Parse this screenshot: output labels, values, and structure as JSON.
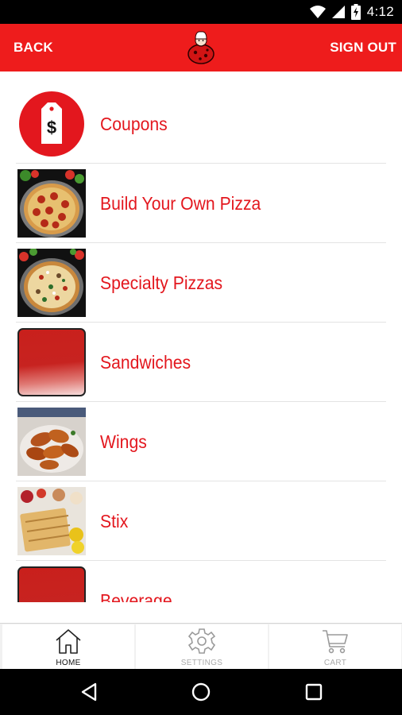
{
  "status_bar": {
    "time": "4:12",
    "icons": [
      "wifi-icon",
      "signal-icon",
      "battery-charging-icon"
    ]
  },
  "app_bar": {
    "back_label": "BACK",
    "sign_out_label": "SIGN OUT",
    "logo_icon": "pizza-chef-logo-icon",
    "background_color": "#ee1c1c"
  },
  "menu": {
    "items": [
      {
        "label": "Coupons",
        "thumbnail": "coupon-tag-icon"
      },
      {
        "label": "Build Your Own Pizza",
        "thumbnail": "pepperoni-pizza-photo"
      },
      {
        "label": "Specialty Pizzas",
        "thumbnail": "specialty-pizza-photo"
      },
      {
        "label": "Sandwiches",
        "thumbnail": "red-placeholder-tile"
      },
      {
        "label": "Wings",
        "thumbnail": "wings-photo"
      },
      {
        "label": "Stix",
        "thumbnail": "stix-photo"
      },
      {
        "label": "Beverage",
        "thumbnail": "red-placeholder-tile"
      }
    ],
    "label_color": "#e3171e"
  },
  "tabs": [
    {
      "label": "HOME",
      "icon": "home-icon",
      "active": true
    },
    {
      "label": "SETTINGS",
      "icon": "gear-icon",
      "active": false
    },
    {
      "label": "CART",
      "icon": "cart-icon",
      "active": false
    }
  ],
  "nav_bar": {
    "buttons": [
      "back-triangle-icon",
      "home-circle-icon",
      "recents-square-icon"
    ]
  }
}
